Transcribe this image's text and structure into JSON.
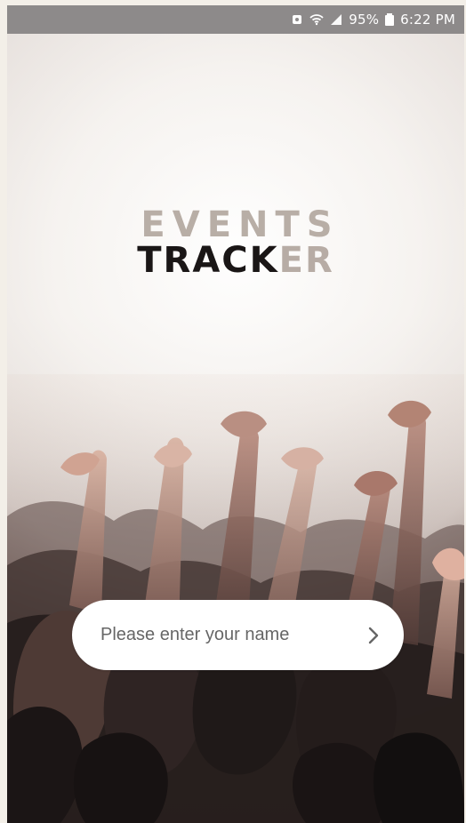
{
  "status_bar": {
    "battery_percent": "95%",
    "time": "6:22 PM",
    "icons": [
      "alarm-icon",
      "wifi-icon",
      "signal-icon",
      "battery-icon"
    ]
  },
  "app": {
    "title_line1": "EVENTS",
    "title_line2_dark": "TRACK",
    "title_line2_light": "ER"
  },
  "name_form": {
    "placeholder": "Please enter your name",
    "value": "",
    "submit_icon": "chevron-right-icon"
  },
  "colors": {
    "status_bar_bg": "#8d8a8a",
    "title_light": "#b8aea6",
    "title_dark": "#1a1616",
    "input_bg": "#ffffff"
  }
}
